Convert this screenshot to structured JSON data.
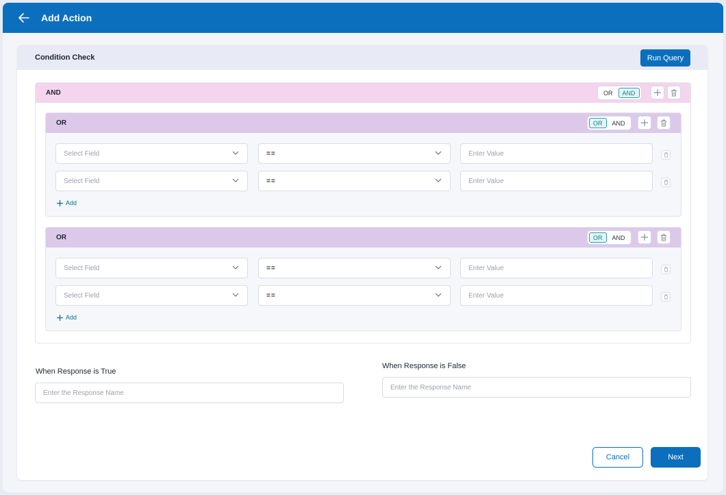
{
  "header": {
    "title": "Add Action",
    "back_icon": "arrow-left-icon"
  },
  "condition_check": {
    "title": "Condition Check",
    "run_query_label": "Run Query",
    "root_group": {
      "label": "AND",
      "toggle": {
        "options": [
          "OR",
          "AND"
        ],
        "selected": "AND"
      },
      "groups": [
        {
          "label": "OR",
          "toggle": {
            "options": [
              "OR",
              "AND"
            ],
            "selected": "OR"
          },
          "rows": [
            {
              "field_placeholder": "Select Field",
              "operator": "==",
              "value_placeholder": "Enter Value"
            },
            {
              "field_placeholder": "Select Field",
              "operator": "==",
              "value_placeholder": "Enter Value"
            }
          ],
          "add_label": "Add"
        },
        {
          "label": "OR",
          "toggle": {
            "options": [
              "OR",
              "AND"
            ],
            "selected": "OR"
          },
          "rows": [
            {
              "field_placeholder": "Select Field",
              "operator": "==",
              "value_placeholder": "Enter Value"
            },
            {
              "field_placeholder": "Select Field",
              "operator": "==",
              "value_placeholder": "Enter Value"
            }
          ],
          "add_label": "Add"
        }
      ]
    }
  },
  "response": {
    "true_label": "When Response is True",
    "true_placeholder": "Enter the Response Name",
    "false_label": "When Response is False",
    "false_placeholder": "Enter the Response Name"
  },
  "footer": {
    "cancel_label": "Cancel",
    "next_label": "Next"
  },
  "colors": {
    "primary": "#0b6fbd",
    "and_group": "#f5d4ee",
    "or_group": "#dcc9ea",
    "toggle_active": "#27a0b3"
  }
}
